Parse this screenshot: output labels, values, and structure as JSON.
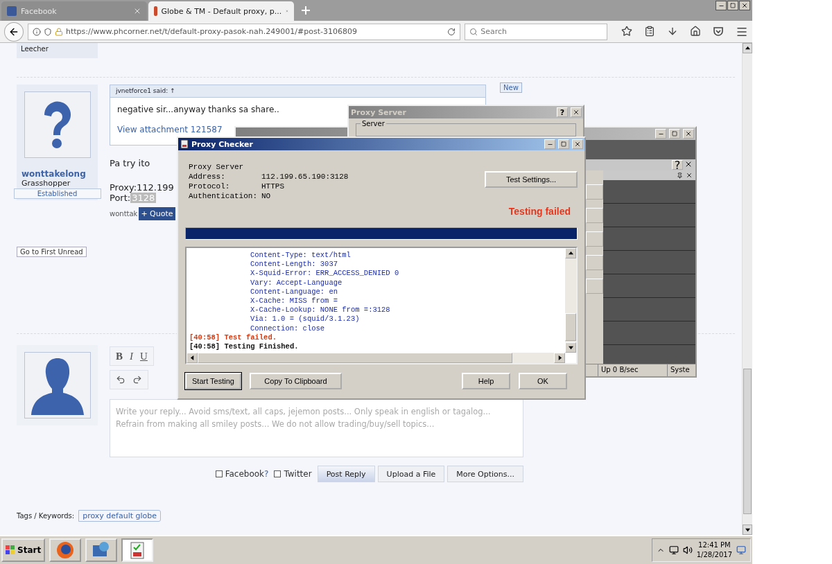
{
  "browser": {
    "tabs": [
      {
        "title": "Facebook",
        "selected": false
      },
      {
        "title": "Globe & TM - Default proxy, p...",
        "selected": true
      }
    ],
    "url": "https://www.phcorner.net/t/default-proxy-pasok-nah.249001/#post-3106809",
    "search": {
      "placeholder": "Search"
    }
  },
  "forum": {
    "previous_rank": "Leecher",
    "post": {
      "author": "wonttakelong",
      "rank": "Grasshopper",
      "badge": "Established",
      "quote": {
        "author": "jvnetforce1 said: ↑",
        "text": "negative sir...anyway thanks sa share..",
        "attachment": "View attachment 121587"
      },
      "new_label": "New",
      "lines": [
        "Pa try ito",
        "Proxy:112.199"
      ],
      "port_label": "Port:",
      "port_value": "3128",
      "signature": "wonttak",
      "quote_button": "+ Quote"
    },
    "first_unread": "Go to First Unread",
    "reply": {
      "toolbar": [
        "B",
        "I",
        "U"
      ],
      "placeholder": "Write your reply... Avoid sms/text, all caps, jejemon posts... Only speak in english or tagalog... Refrain from making all smiley posts... We do not allow trading/buy/sell topics...",
      "share": [
        {
          "label": "Facebook",
          "hint": "?",
          "checked": false
        },
        {
          "label": "Twitter",
          "checked": false
        }
      ],
      "buttons": [
        "Post Reply",
        "Upload a File",
        "More Options..."
      ]
    },
    "tags_label": "Tags / Keywords:",
    "tags": [
      "proxy default globe"
    ]
  },
  "background_window": {
    "status": [
      "Up 0 B/sec",
      "Syste"
    ]
  },
  "proxy_server_dialog": {
    "title": "Proxy Server",
    "help": "?",
    "group": "Server"
  },
  "proxy_checker": {
    "title": "Proxy Checker",
    "heading": "Proxy Server",
    "fields": [
      {
        "label": "Address:",
        "value": "112.199.65.190:3128"
      },
      {
        "label": "Protocol:",
        "value": "HTTPS"
      },
      {
        "label": "Authentication:",
        "value": "NO"
      }
    ],
    "test_settings": "Test Settings...",
    "status": "Testing failed",
    "progress": {
      "level": 1
    },
    "log": [
      {
        "kind": "header",
        "text": "Content-Type: text/html"
      },
      {
        "kind": "header",
        "text": "Content-Length: 3037"
      },
      {
        "kind": "header",
        "text": "X-Squid-Error: ERR_ACCESS_DENIED 0"
      },
      {
        "kind": "header",
        "text": "Vary: Accept-Language"
      },
      {
        "kind": "header",
        "text": "Content-Language: en"
      },
      {
        "kind": "header",
        "text": "X-Cache: MISS from ="
      },
      {
        "kind": "header",
        "text": "X-Cache-Lookup: NONE from =:3128"
      },
      {
        "kind": "header",
        "text": "Via: 1.0 = (squid/3.1.23)"
      },
      {
        "kind": "header",
        "text": "Connection: close"
      },
      {
        "kind": "error",
        "text": "[40:58] Test failed."
      },
      {
        "kind": "info",
        "text": "[40:58] Testing Finished."
      }
    ],
    "buttons": [
      {
        "label": "Start Testing",
        "focused": true
      },
      {
        "label": "Copy To Clipboard",
        "focused": false
      },
      {
        "label": "Help",
        "focused": false
      },
      {
        "label": "OK",
        "focused": false
      }
    ]
  },
  "taskbar": {
    "start": "Start",
    "tasks": [
      {
        "kind": "browser",
        "selected": false
      },
      {
        "kind": "network",
        "selected": false
      },
      {
        "kind": "checker",
        "selected": true
      }
    ],
    "time": "12:41 PM",
    "date": "1/28/2017"
  }
}
